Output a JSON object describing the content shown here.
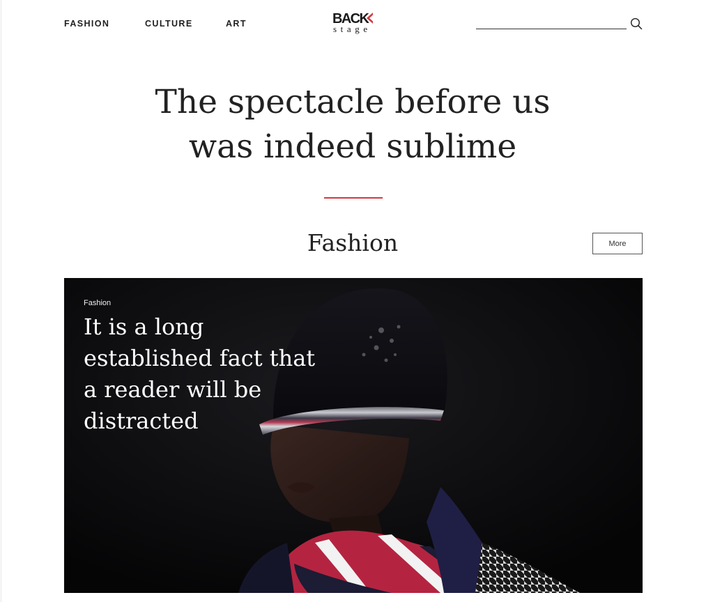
{
  "nav": {
    "items": [
      {
        "label": "FASHION"
      },
      {
        "label": "CULTURE"
      },
      {
        "label": "ART"
      }
    ]
  },
  "logo": {
    "word": "BACK",
    "sub": "stage",
    "accent_color": "#d6383f"
  },
  "search": {
    "value": "",
    "placeholder": "",
    "icon": "search-icon"
  },
  "hero": {
    "title": "The spectacle before us was indeed sublime",
    "divider_color": "#d6383f"
  },
  "section": {
    "title": "Fashion",
    "more_label": "More"
  },
  "feature": {
    "kicker": "Fashion",
    "title": "It is a long established fact that a reader will be distracted"
  }
}
